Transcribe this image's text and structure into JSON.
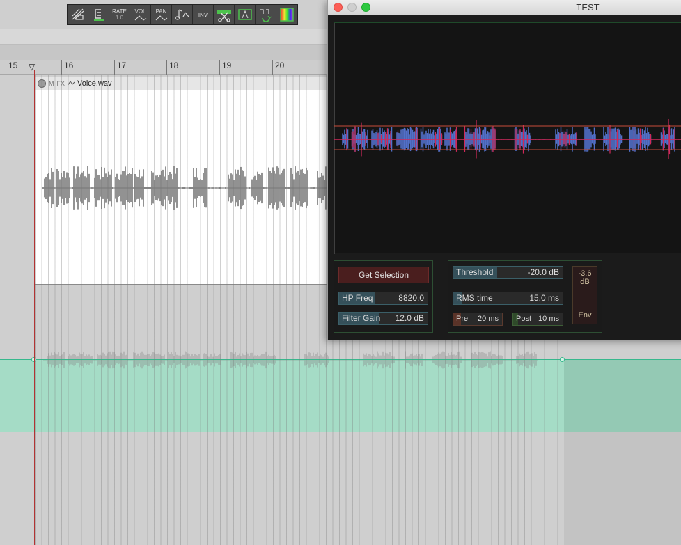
{
  "toolbar": {
    "buttons": [
      {
        "name": "ripple-edit-icon",
        "label": "",
        "sub": ""
      },
      {
        "name": "snap-icon",
        "label": "",
        "sub": ""
      },
      {
        "name": "rate",
        "label": "RATE",
        "sub": "1.0"
      },
      {
        "name": "vol",
        "label": "VOL",
        "sub": ""
      },
      {
        "name": "pan",
        "label": "PAN",
        "sub": ""
      },
      {
        "name": "pitch-icon",
        "label": "",
        "sub": ""
      },
      {
        "name": "inv",
        "label": "INV",
        "sub": ""
      },
      {
        "name": "split-icon",
        "label": "",
        "sub": ""
      },
      {
        "name": "fade-icon",
        "label": "",
        "sub": ""
      },
      {
        "name": "loop-icon",
        "label": "",
        "sub": ""
      },
      {
        "name": "color-icon",
        "label": "",
        "sub": ""
      }
    ]
  },
  "ruler": {
    "marks": [
      "15",
      "16",
      "17",
      "18",
      "19",
      "20"
    ]
  },
  "item": {
    "mute_label": "M",
    "fx_label": "FX",
    "filename": "Voice.wav"
  },
  "plugin": {
    "window_title": "TEST",
    "get_selection_label": "Get Selection",
    "hp_freq": {
      "label": "HP Freq",
      "value": "8820.0",
      "fraction": 0.4
    },
    "filter_gain": {
      "label": "Filter Gain",
      "value": "12.0 dB",
      "fraction": 0.45
    },
    "threshold": {
      "label": "Threshold",
      "value": "-20.0 dB",
      "fraction": 0.4
    },
    "rms_time": {
      "label": "RMS time",
      "value": "15.0 ms",
      "fraction": 0.08
    },
    "pre": {
      "label": "Pre",
      "value": "20 ms",
      "fraction": 0.15
    },
    "post": {
      "label": "Post",
      "value": "10 ms",
      "fraction": 0.1
    },
    "env_meter": {
      "level": "-3.6 dB",
      "label": "Env"
    }
  },
  "colors": {
    "envelope": "#37b88d",
    "waveform_blue": "#5270c8",
    "waveform_red": "#d0285a",
    "threshold_line": "#c94b3a"
  }
}
